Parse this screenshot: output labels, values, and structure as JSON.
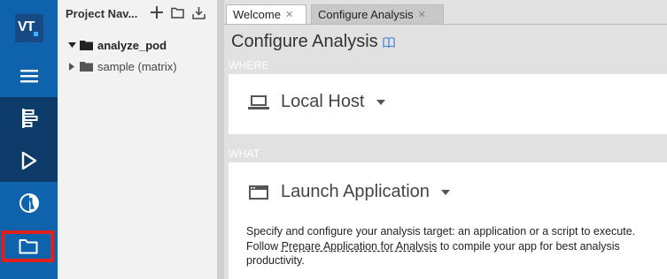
{
  "app": {
    "logo_text": "VT",
    "accent": "#0f62ac",
    "highlight": "#e0201f"
  },
  "activity_bar": {
    "items": [
      {
        "name": "menu",
        "icon": "hamburger-icon"
      },
      {
        "name": "configure",
        "icon": "configure-analysis-icon"
      },
      {
        "name": "run",
        "icon": "play-icon"
      },
      {
        "name": "results",
        "icon": "results-icon"
      },
      {
        "name": "project-navigator",
        "icon": "folder-icon",
        "selected": true
      }
    ]
  },
  "navigator": {
    "title": "Project Nav...",
    "tools": [
      "add-icon",
      "new-folder-icon",
      "download-icon"
    ],
    "tree": [
      {
        "label": "analyze_pod",
        "expanded": true,
        "bold": true
      },
      {
        "label": "sample (matrix)",
        "expanded": false,
        "bold": false
      }
    ]
  },
  "tabs": [
    {
      "label": "Welcome",
      "active": false
    },
    {
      "label": "Configure Analysis",
      "active": true
    }
  ],
  "main": {
    "title": "Configure Analysis",
    "where": {
      "section_label": "WHERE",
      "target": "Local Host"
    },
    "what": {
      "section_label": "WHAT",
      "target": "Launch Application",
      "description_pre": "Specify and configure your analysis target: an application or a script to execute. Follow ",
      "description_link": "Prepare Application for Analysis",
      "description_post": " to compile your app for best analysis productivity."
    }
  }
}
